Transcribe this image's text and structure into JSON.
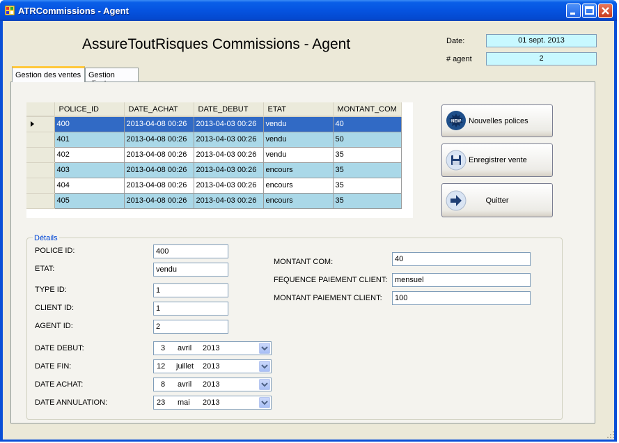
{
  "window": {
    "title": "ATRCommissions - Agent"
  },
  "header": {
    "app_title": "AssureToutRisques Commissions - Agent",
    "date_label": "Date:",
    "date_value": "01 sept. 2013",
    "agent_label": "# agent",
    "agent_value": "2"
  },
  "tabs": [
    {
      "label": "Gestion des ventes"
    },
    {
      "label": "Gestion clients"
    }
  ],
  "grid": {
    "columns": [
      "POLICE_ID",
      "DATE_ACHAT",
      "DATE_DEBUT",
      "ETAT",
      "MONTANT_COM"
    ],
    "rows": [
      [
        "400",
        "2013-04-08 00:26",
        "2013-04-03 00:26",
        "vendu",
        "40"
      ],
      [
        "401",
        "2013-04-08 00:26",
        "2013-04-03 00:26",
        "vendu",
        "50"
      ],
      [
        "402",
        "2013-04-08 00:26",
        "2013-04-03 00:26",
        "vendu",
        "35"
      ],
      [
        "403",
        "2013-04-08 00:26",
        "2013-04-03 00:26",
        "encours",
        "35"
      ],
      [
        "404",
        "2013-04-08 00:26",
        "2013-04-03 00:26",
        "encours",
        "35"
      ],
      [
        "405",
        "2013-04-08 00:26",
        "2013-04-03 00:26",
        "encours",
        "35"
      ]
    ]
  },
  "actions": {
    "new_policies": "Nouvelles polices",
    "save_sale": "Enregistrer vente",
    "quit": "Quitter"
  },
  "details": {
    "legend": "Détails",
    "police_id_label": "POLICE ID:",
    "police_id": "400",
    "etat_label": "ETAT:",
    "etat": "vendu",
    "type_id_label": "TYPE ID:",
    "type_id": "1",
    "client_id_label": "CLIENT ID:",
    "client_id": "1",
    "agent_id_label": "AGENT ID:",
    "agent_id": "2",
    "montant_com_label": "MONTANT COM:",
    "montant_com": "40",
    "frequence_label": "FEQUENCE PAIEMENT CLIENT:",
    "frequence": "mensuel",
    "montant_paiement_label": "MONTANT PAIEMENT CLIENT:",
    "montant_paiement": "100",
    "date_debut_label": "DATE DEBUT:",
    "date_debut": {
      "day": "3",
      "month": "avril",
      "year": "2013"
    },
    "date_fin_label": "DATE FIN:",
    "date_fin": {
      "day": "12",
      "month": "juillet",
      "year": "2013"
    },
    "date_achat_label": "DATE ACHAT:",
    "date_achat": {
      "day": "8",
      "month": "avril",
      "year": "2013"
    },
    "date_annulation_label": "DATE ANNULATION:",
    "date_annulation": {
      "day": "23",
      "month": "mai",
      "year": "2013"
    }
  },
  "colors": {
    "selected_row": "#316ac5",
    "alt_row": "#aad8e8",
    "info_box": "#c8f8ff",
    "legend": "#0046d5"
  }
}
